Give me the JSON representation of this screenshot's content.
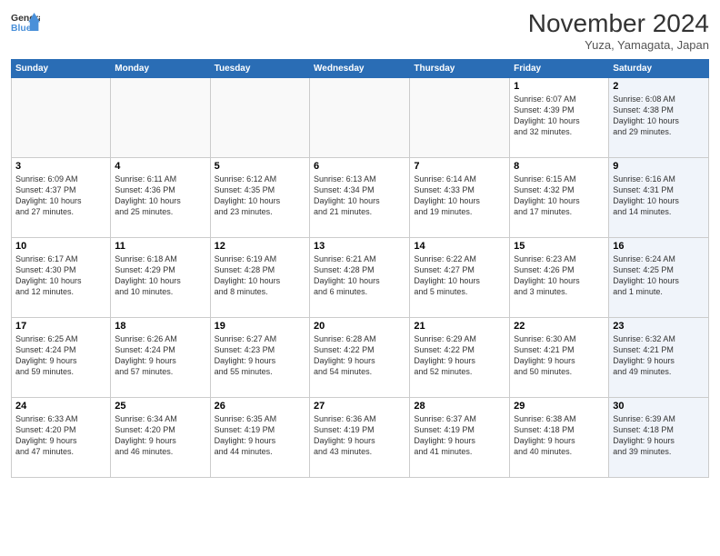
{
  "header": {
    "logo_line1": "General",
    "logo_line2": "Blue",
    "month_title": "November 2024",
    "subtitle": "Yuza, Yamagata, Japan"
  },
  "weekdays": [
    "Sunday",
    "Monday",
    "Tuesday",
    "Wednesday",
    "Thursday",
    "Friday",
    "Saturday"
  ],
  "weeks": [
    [
      {
        "day": "",
        "info": "",
        "shaded": false,
        "empty": true
      },
      {
        "day": "",
        "info": "",
        "shaded": false,
        "empty": true
      },
      {
        "day": "",
        "info": "",
        "shaded": false,
        "empty": true
      },
      {
        "day": "",
        "info": "",
        "shaded": false,
        "empty": true
      },
      {
        "day": "",
        "info": "",
        "shaded": false,
        "empty": true
      },
      {
        "day": "1",
        "info": "Sunrise: 6:07 AM\nSunset: 4:39 PM\nDaylight: 10 hours\nand 32 minutes.",
        "shaded": false,
        "empty": false
      },
      {
        "day": "2",
        "info": "Sunrise: 6:08 AM\nSunset: 4:38 PM\nDaylight: 10 hours\nand 29 minutes.",
        "shaded": true,
        "empty": false
      }
    ],
    [
      {
        "day": "3",
        "info": "Sunrise: 6:09 AM\nSunset: 4:37 PM\nDaylight: 10 hours\nand 27 minutes.",
        "shaded": false,
        "empty": false
      },
      {
        "day": "4",
        "info": "Sunrise: 6:11 AM\nSunset: 4:36 PM\nDaylight: 10 hours\nand 25 minutes.",
        "shaded": false,
        "empty": false
      },
      {
        "day": "5",
        "info": "Sunrise: 6:12 AM\nSunset: 4:35 PM\nDaylight: 10 hours\nand 23 minutes.",
        "shaded": false,
        "empty": false
      },
      {
        "day": "6",
        "info": "Sunrise: 6:13 AM\nSunset: 4:34 PM\nDaylight: 10 hours\nand 21 minutes.",
        "shaded": false,
        "empty": false
      },
      {
        "day": "7",
        "info": "Sunrise: 6:14 AM\nSunset: 4:33 PM\nDaylight: 10 hours\nand 19 minutes.",
        "shaded": false,
        "empty": false
      },
      {
        "day": "8",
        "info": "Sunrise: 6:15 AM\nSunset: 4:32 PM\nDaylight: 10 hours\nand 17 minutes.",
        "shaded": false,
        "empty": false
      },
      {
        "day": "9",
        "info": "Sunrise: 6:16 AM\nSunset: 4:31 PM\nDaylight: 10 hours\nand 14 minutes.",
        "shaded": true,
        "empty": false
      }
    ],
    [
      {
        "day": "10",
        "info": "Sunrise: 6:17 AM\nSunset: 4:30 PM\nDaylight: 10 hours\nand 12 minutes.",
        "shaded": false,
        "empty": false
      },
      {
        "day": "11",
        "info": "Sunrise: 6:18 AM\nSunset: 4:29 PM\nDaylight: 10 hours\nand 10 minutes.",
        "shaded": false,
        "empty": false
      },
      {
        "day": "12",
        "info": "Sunrise: 6:19 AM\nSunset: 4:28 PM\nDaylight: 10 hours\nand 8 minutes.",
        "shaded": false,
        "empty": false
      },
      {
        "day": "13",
        "info": "Sunrise: 6:21 AM\nSunset: 4:28 PM\nDaylight: 10 hours\nand 6 minutes.",
        "shaded": false,
        "empty": false
      },
      {
        "day": "14",
        "info": "Sunrise: 6:22 AM\nSunset: 4:27 PM\nDaylight: 10 hours\nand 5 minutes.",
        "shaded": false,
        "empty": false
      },
      {
        "day": "15",
        "info": "Sunrise: 6:23 AM\nSunset: 4:26 PM\nDaylight: 10 hours\nand 3 minutes.",
        "shaded": false,
        "empty": false
      },
      {
        "day": "16",
        "info": "Sunrise: 6:24 AM\nSunset: 4:25 PM\nDaylight: 10 hours\nand 1 minute.",
        "shaded": true,
        "empty": false
      }
    ],
    [
      {
        "day": "17",
        "info": "Sunrise: 6:25 AM\nSunset: 4:24 PM\nDaylight: 9 hours\nand 59 minutes.",
        "shaded": false,
        "empty": false
      },
      {
        "day": "18",
        "info": "Sunrise: 6:26 AM\nSunset: 4:24 PM\nDaylight: 9 hours\nand 57 minutes.",
        "shaded": false,
        "empty": false
      },
      {
        "day": "19",
        "info": "Sunrise: 6:27 AM\nSunset: 4:23 PM\nDaylight: 9 hours\nand 55 minutes.",
        "shaded": false,
        "empty": false
      },
      {
        "day": "20",
        "info": "Sunrise: 6:28 AM\nSunset: 4:22 PM\nDaylight: 9 hours\nand 54 minutes.",
        "shaded": false,
        "empty": false
      },
      {
        "day": "21",
        "info": "Sunrise: 6:29 AM\nSunset: 4:22 PM\nDaylight: 9 hours\nand 52 minutes.",
        "shaded": false,
        "empty": false
      },
      {
        "day": "22",
        "info": "Sunrise: 6:30 AM\nSunset: 4:21 PM\nDaylight: 9 hours\nand 50 minutes.",
        "shaded": false,
        "empty": false
      },
      {
        "day": "23",
        "info": "Sunrise: 6:32 AM\nSunset: 4:21 PM\nDaylight: 9 hours\nand 49 minutes.",
        "shaded": true,
        "empty": false
      }
    ],
    [
      {
        "day": "24",
        "info": "Sunrise: 6:33 AM\nSunset: 4:20 PM\nDaylight: 9 hours\nand 47 minutes.",
        "shaded": false,
        "empty": false
      },
      {
        "day": "25",
        "info": "Sunrise: 6:34 AM\nSunset: 4:20 PM\nDaylight: 9 hours\nand 46 minutes.",
        "shaded": false,
        "empty": false
      },
      {
        "day": "26",
        "info": "Sunrise: 6:35 AM\nSunset: 4:19 PM\nDaylight: 9 hours\nand 44 minutes.",
        "shaded": false,
        "empty": false
      },
      {
        "day": "27",
        "info": "Sunrise: 6:36 AM\nSunset: 4:19 PM\nDaylight: 9 hours\nand 43 minutes.",
        "shaded": false,
        "empty": false
      },
      {
        "day": "28",
        "info": "Sunrise: 6:37 AM\nSunset: 4:19 PM\nDaylight: 9 hours\nand 41 minutes.",
        "shaded": false,
        "empty": false
      },
      {
        "day": "29",
        "info": "Sunrise: 6:38 AM\nSunset: 4:18 PM\nDaylight: 9 hours\nand 40 minutes.",
        "shaded": false,
        "empty": false
      },
      {
        "day": "30",
        "info": "Sunrise: 6:39 AM\nSunset: 4:18 PM\nDaylight: 9 hours\nand 39 minutes.",
        "shaded": true,
        "empty": false
      }
    ]
  ]
}
